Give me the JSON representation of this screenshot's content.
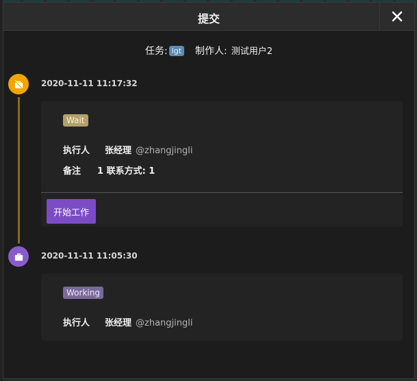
{
  "dialog": {
    "title": "提交",
    "close_icon": "close-icon"
  },
  "summary": {
    "task_label": "任务:",
    "task_value": "lgt",
    "creator_label": "制作人:",
    "creator_value": "测试用户2"
  },
  "timeline": [
    {
      "time": "2020-11-11 11:17:32",
      "icon": "suitcase-off-icon",
      "dot_color": "#f0a500",
      "status": "Wait",
      "assignee_label": "执行人",
      "assignee_name": "张经理",
      "assignee_handle": "@zhangjingli",
      "note_label": "备注",
      "note_value": "1 联系方式: 1",
      "action_label": "开始工作"
    },
    {
      "time": "2020-11-11 11:05:30",
      "icon": "briefcase-icon",
      "dot_color": "#8a5cc9",
      "status": "Working",
      "assignee_label": "执行人",
      "assignee_name": "张经理",
      "assignee_handle": "@zhangjingli"
    }
  ]
}
